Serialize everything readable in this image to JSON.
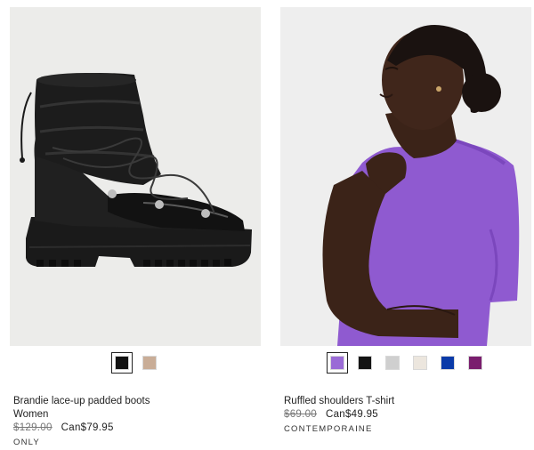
{
  "products": [
    {
      "name": "Brandie lace-up padded boots",
      "category": "Women",
      "old_price": "$129.00",
      "sale_price": "Can$79.95",
      "tag": "ONLY",
      "image_icon": "black-padded-boot-image",
      "swatches": [
        {
          "color": "#111111",
          "selected": true
        },
        {
          "color": "#c9ad97",
          "selected": false
        }
      ]
    },
    {
      "name": "Ruffled shoulders T-shirt",
      "old_price": "$69.00",
      "sale_price": "Can$49.95",
      "tag": "CONTEMPORAINE",
      "image_icon": "model-purple-tshirt-image",
      "swatches": [
        {
          "color": "#9a6bd6",
          "selected": true
        },
        {
          "color": "#141414",
          "selected": false
        },
        {
          "color": "#cfcfcf",
          "selected": false
        },
        {
          "color": "#ece6de",
          "selected": false
        },
        {
          "color": "#0a3aa8",
          "selected": false
        },
        {
          "color": "#7a1e6e",
          "selected": false
        }
      ]
    }
  ]
}
